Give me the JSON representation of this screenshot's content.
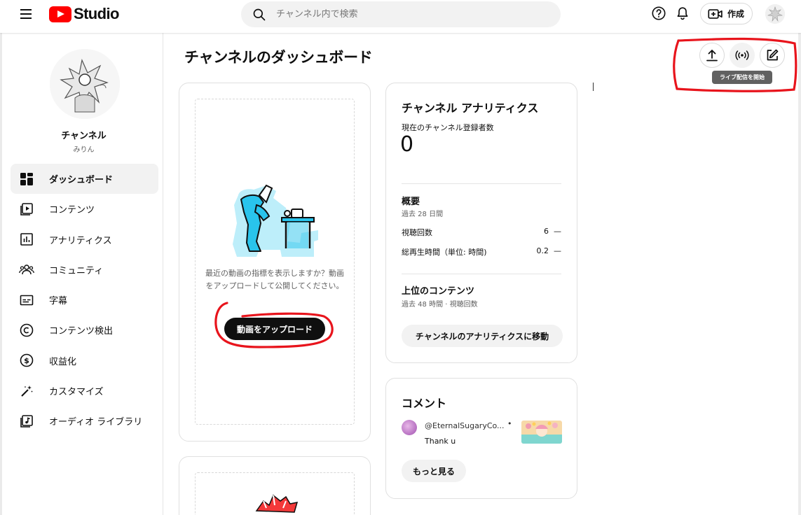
{
  "header": {
    "logo_text": "Studio",
    "search_placeholder": "チャンネル内で検索",
    "create_label": "作成",
    "icons": [
      "menu-icon",
      "help-icon",
      "bell-icon",
      "video-add-icon",
      "search-icon"
    ]
  },
  "sidebar": {
    "channel_name": "チャンネル",
    "channel_handle": "みりん",
    "items": [
      {
        "label": "ダッシュボード",
        "icon": "dashboard-icon",
        "active": true
      },
      {
        "label": "コンテンツ",
        "icon": "content-icon",
        "active": false
      },
      {
        "label": "アナリティクス",
        "icon": "analytics-icon",
        "active": false
      },
      {
        "label": "コミュニティ",
        "icon": "community-icon",
        "active": false
      },
      {
        "label": "字幕",
        "icon": "subtitles-icon",
        "active": false
      },
      {
        "label": "コンテンツ検出",
        "icon": "copyright-icon",
        "active": false
      },
      {
        "label": "収益化",
        "icon": "dollar-icon",
        "active": false
      },
      {
        "label": "カスタマイズ",
        "icon": "magic-wand-icon",
        "active": false
      },
      {
        "label": "オーディオ ライブラリ",
        "icon": "audio-library-icon",
        "active": false
      }
    ]
  },
  "main": {
    "title": "チャンネルのダッシュボード",
    "upload_card": {
      "prompt": "最近の動画の指標を表示しますか？動画をアップロードして公開してください。",
      "button": "動画をアップロード"
    },
    "analytics": {
      "title": "チャンネル アナリティクス",
      "subscribers_label": "現在のチャンネル登録者数",
      "subscribers_value": "0",
      "summary_title": "概要",
      "summary_period": "過去 28 日間",
      "rows": [
        {
          "label": "視聴回数",
          "value": "6",
          "delta": "—"
        },
        {
          "label": "総再生時間（単位: 時間)",
          "value": "0.2",
          "delta": "—"
        }
      ],
      "top_content_title": "上位のコンテンツ",
      "top_content_period": "過去 48 時間 · 視聴回数",
      "button": "チャンネルのアナリティクスに移動"
    },
    "comments": {
      "title": "コメント",
      "user": "@EternalSugaryCo...",
      "separator": "•",
      "text": "Thank u",
      "more_button": "もっと見る"
    }
  },
  "actions": {
    "tooltip": "ライブ配信を開始",
    "icons": [
      "upload-icon",
      "live-icon",
      "edit-icon"
    ]
  },
  "colors": {
    "brand_red": "#ff0000",
    "annotation_red": "#e8141c",
    "text": "#0f0f0f",
    "muted": "#606060"
  }
}
